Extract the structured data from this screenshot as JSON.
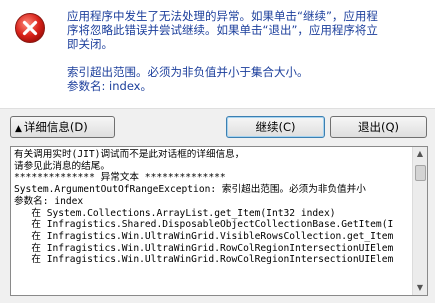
{
  "dialog": {
    "message_lines": [
      "应用程序中发生了无法处理的异常。如果单击“继续”，应用程",
      "序将忽略此错误并尝试继续。如果单击“退出”，应用程序将立",
      "即关闭。"
    ],
    "error_lines": [
      "索引超出范围。必须为非负值并小于集合大小。",
      "参数名: index。"
    ],
    "icon": "error-icon",
    "accent_color": "#1c3f9c"
  },
  "buttons": {
    "details_label": "详细信息(D)",
    "details_arrow": "▲",
    "continue_label": "继续(C)",
    "quit_label": "退出(Q)"
  },
  "details": {
    "lines": [
      "有关调用实时(JIT)调试而不是此对话框的详细信息，",
      "请参见此消息的结尾。",
      "",
      "************** 异常文本 **************",
      "System.ArgumentOutOfRangeException: 索引超出范围。必须为非负值并小",
      "参数名: index",
      "   在 System.Collections.ArrayList.get_Item(Int32 index)",
      "   在 Infragistics.Shared.DisposableObjectCollectionBase.GetItem(I",
      "   在 Infragistics.Win.UltraWinGrid.VisibleRowsCollection.get_Item",
      "   在 Infragistics.Win.UltraWinGrid.RowColRegionIntersectionUIElem",
      "   在 Infragistics.Win.UltraWinGrid.RowColRegionIntersectionUIElem"
    ]
  }
}
